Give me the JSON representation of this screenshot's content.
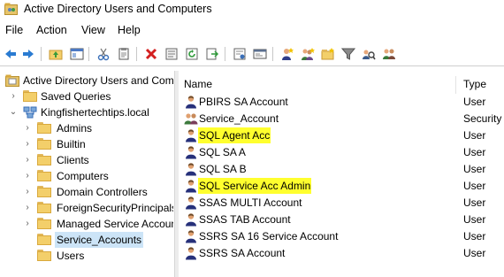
{
  "window": {
    "title": "Active Directory Users and Computers"
  },
  "menu": [
    "File",
    "Action",
    "View",
    "Help"
  ],
  "toolbar_icons": [
    "back-arrow-icon",
    "forward-arrow-icon",
    "up-folder-icon",
    "console-tree-icon",
    "cut-icon",
    "copy-icon",
    "delete-icon",
    "properties-icon",
    "refresh-icon",
    "export-icon",
    "help-icon",
    "console-icon",
    "new-user-icon",
    "new-group-icon",
    "new-ou-icon",
    "filter-icon",
    "find-icon"
  ],
  "tree": {
    "root": "Active Directory Users and Com",
    "saved_queries": "Saved Queries",
    "domain": "Kingfishertechtips.local",
    "items": [
      "Admins",
      "Builtin",
      "Clients",
      "Computers",
      "Domain Controllers",
      "ForeignSecurityPrincipals",
      "Managed Service Accoun",
      "Service_Accounts",
      "Users"
    ],
    "selected": "Service_Accounts"
  },
  "list": {
    "columns": {
      "name": "Name",
      "type": "Type"
    },
    "rows": [
      {
        "name": "PBIRS SA Account",
        "type": "User",
        "highlight": false,
        "icon": "user-icon"
      },
      {
        "name": "Service_Account",
        "type": "Security",
        "highlight": false,
        "icon": "group-icon"
      },
      {
        "name": "SQL Agent Acc",
        "type": "User",
        "highlight": true,
        "icon": "user-icon"
      },
      {
        "name": "SQL SA A",
        "type": "User",
        "highlight": false,
        "icon": "user-icon"
      },
      {
        "name": "SQL SA B",
        "type": "User",
        "highlight": false,
        "icon": "user-icon"
      },
      {
        "name": "SQL Service Acc Admin",
        "type": "User",
        "highlight": true,
        "icon": "user-icon"
      },
      {
        "name": "SSAS MULTI Account",
        "type": "User",
        "highlight": false,
        "icon": "user-icon"
      },
      {
        "name": "SSAS TAB Account",
        "type": "User",
        "highlight": false,
        "icon": "user-icon"
      },
      {
        "name": "SSRS SA 16 Service Account",
        "type": "User",
        "highlight": false,
        "icon": "user-icon"
      },
      {
        "name": "SSRS SA Account",
        "type": "User",
        "highlight": false,
        "icon": "user-icon"
      }
    ]
  },
  "colors": {
    "selection": "#cce4f7",
    "highlight": "#ffff2e",
    "folder": "#f3cf6a"
  }
}
